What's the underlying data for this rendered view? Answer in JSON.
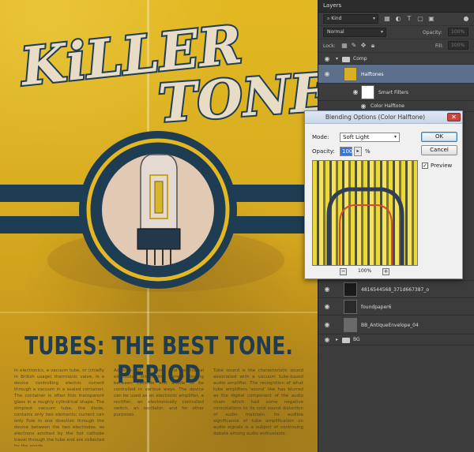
{
  "poster": {
    "title_line1": "KiLLER",
    "title_line2": "TONE",
    "headline": "TUBES: THE BEST TONE. PERIOD",
    "body_col1": "In electronics, a vacuum tube, or (chiefly in British usage) thermionic valve, is a device controlling electric current through a vacuum in a sealed container. The container is often thin transparent glass in a roughly cylindrical shape. The simplest vacuum tube, the diode, contains only two elements; current can only flow in one direction through the device between the two electrodes, as electrons emitted by the hot cathode travel through the tube and are collected by the anode.",
    "body_col2": "Addition of a third and additional electrodes allows the current flowing between cathode and anode to be controlled in various ways. The device can be used as an electronic amplifier, a rectifier, an electronically controlled switch, an oscillator, and for other purposes.",
    "body_col3": "Tube sound is the characteristic sound associated with a vacuum tube-based audio amplifier. The recognition of what tube amplifiers 'sound' like has blurred as the digital component of the audio chain which had some negative connotations to its cold sound distortion of audio maintain. Its audible significance of tube amplification on audio signals is a subject of continuing debate among audio enthusiasts."
  },
  "panel": {
    "tab_label": "Layers",
    "kind_label": "Kind",
    "blend_mode": "Normal",
    "opacity_label": "Opacity:",
    "opacity_value": "100%",
    "lock_label": "Lock:",
    "fill_label": "Fill:",
    "fill_value": "100%",
    "layers": [
      {
        "name": "Comp"
      },
      {
        "name": "Halftones"
      },
      {
        "name": "Smart Filters"
      },
      {
        "name": "Color Halftone"
      },
      {
        "name": "4816544568_371d667387_o"
      },
      {
        "name": "foundpaper6"
      },
      {
        "name": "BB_AntiqueEnvelope_04"
      },
      {
        "name": "BG"
      }
    ]
  },
  "dialog": {
    "title": "Blending Options (Color Halftone)",
    "mode_label": "Mode:",
    "mode_value": "Soft Light",
    "opacity_label": "Opacity:",
    "opacity_value": "100",
    "opacity_unit": "%",
    "ok_label": "OK",
    "cancel_label": "Cancel",
    "preview_label": "Preview",
    "zoom_value": "100%"
  }
}
